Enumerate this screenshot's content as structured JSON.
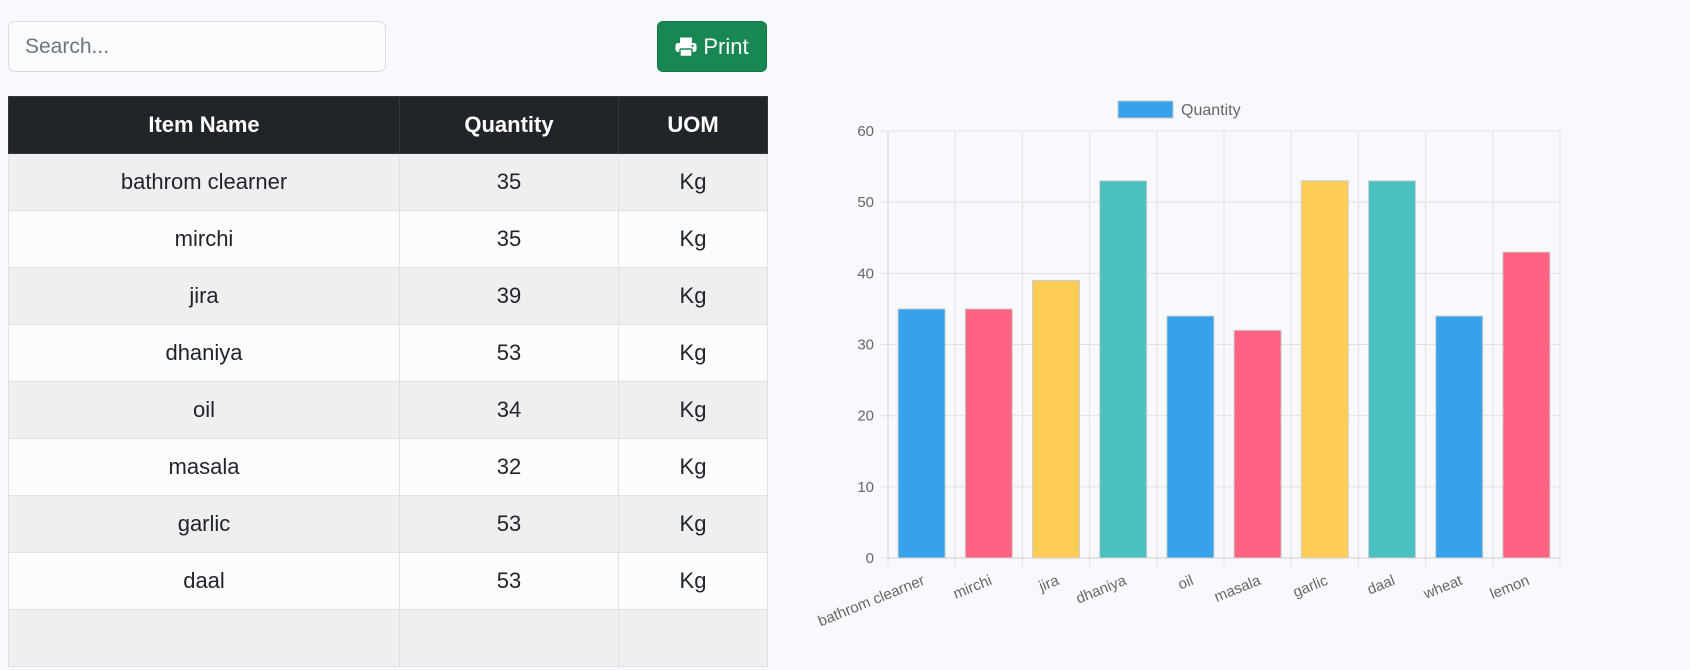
{
  "search": {
    "placeholder": "Search...",
    "value": ""
  },
  "toolbar": {
    "print_label": "Print",
    "print_icon": "printer-icon"
  },
  "table": {
    "headers": {
      "item_name": "Item Name",
      "quantity": "Quantity",
      "uom": "UOM"
    },
    "rows": [
      {
        "item": "bathrom clearner",
        "qty": "35",
        "uom": "Kg"
      },
      {
        "item": "mirchi",
        "qty": "35",
        "uom": "Kg"
      },
      {
        "item": "jira",
        "qty": "39",
        "uom": "Kg"
      },
      {
        "item": "dhaniya",
        "qty": "53",
        "uom": "Kg"
      },
      {
        "item": "oil",
        "qty": "34",
        "uom": "Kg"
      },
      {
        "item": "masala",
        "qty": "32",
        "uom": "Kg"
      },
      {
        "item": "garlic",
        "qty": "53",
        "uom": "Kg"
      },
      {
        "item": "daal",
        "qty": "53",
        "uom": "Kg"
      },
      {
        "item": "",
        "qty": "",
        "uom": ""
      }
    ]
  },
  "colors": {
    "blue": "#36a2eb",
    "pink": "#ff6384",
    "yellow": "#ffcd56",
    "teal": "#4bc0c0",
    "print_button": "#198754",
    "table_header": "#212529"
  },
  "chart_data": {
    "type": "bar",
    "legend": {
      "label": "Quantity",
      "position": "top",
      "color": "#36a2eb"
    },
    "categories": [
      "bathrom clearner",
      "mirchi",
      "jira",
      "dhaniya",
      "oil",
      "masala",
      "garlic",
      "daal",
      "wheat",
      "lemon"
    ],
    "series": [
      {
        "name": "Quantity",
        "values": [
          35,
          35,
          39,
          53,
          34,
          32,
          53,
          53,
          34,
          43
        ]
      }
    ],
    "bar_colors": [
      "#36a2eb",
      "#ff6384",
      "#ffcd56",
      "#4bc0c0",
      "#36a2eb",
      "#ff6384",
      "#ffcd56",
      "#4bc0c0",
      "#36a2eb",
      "#ff6384"
    ],
    "ylim": [
      0,
      60
    ],
    "yticks": [
      0,
      10,
      20,
      30,
      40,
      50,
      60
    ],
    "grid": true
  }
}
